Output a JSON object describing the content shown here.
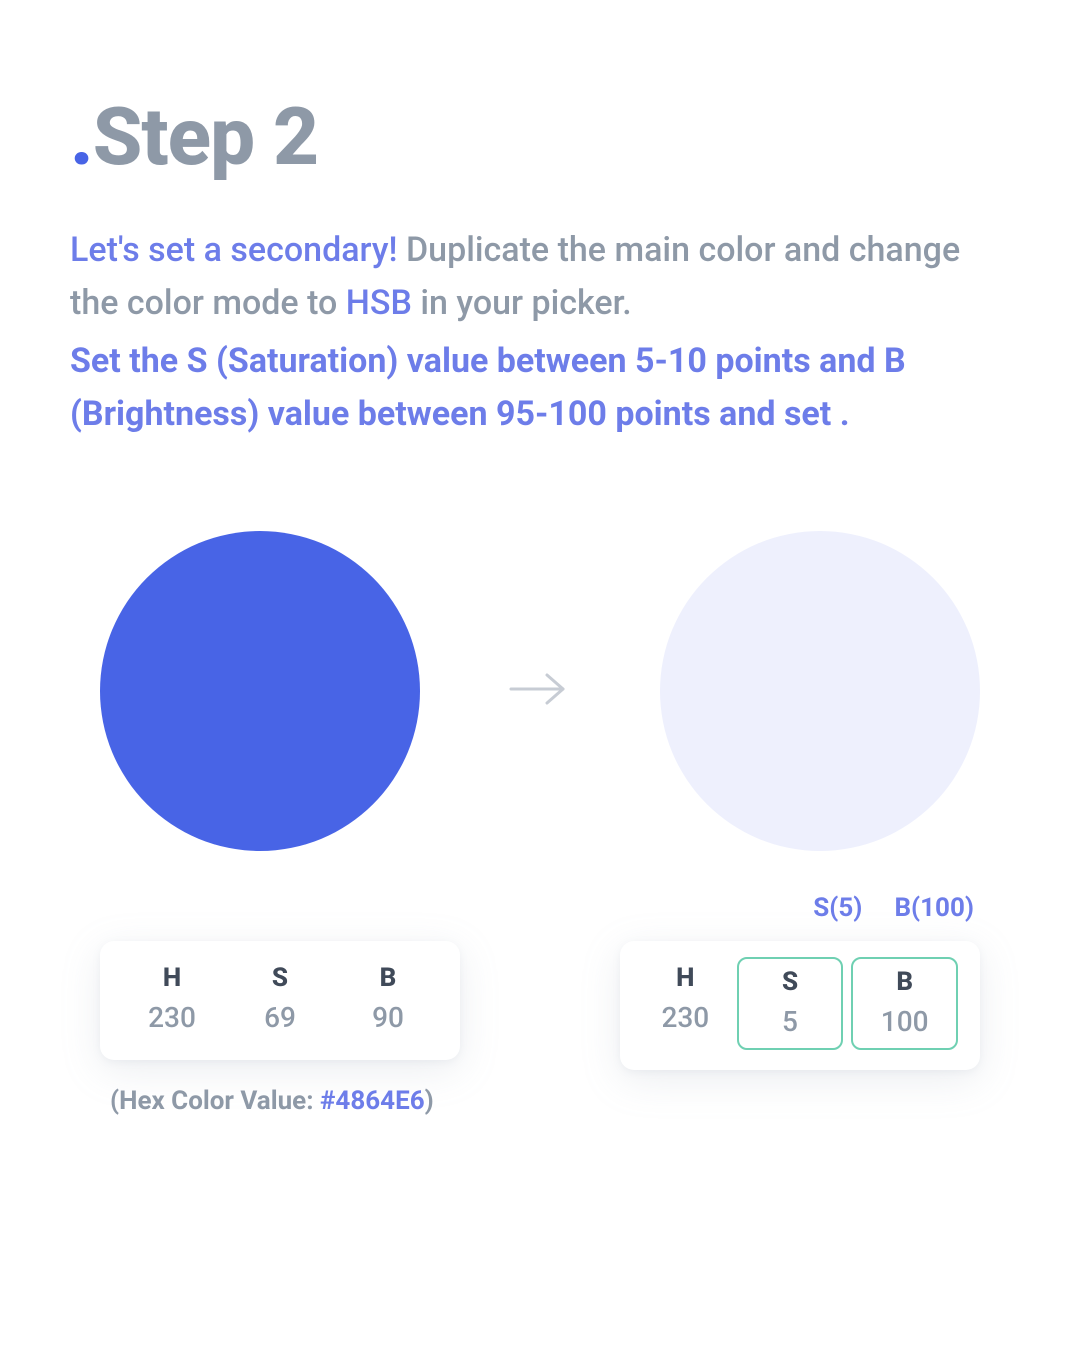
{
  "title": {
    "dot": ".",
    "text": "Step 2"
  },
  "body": {
    "lead": "Let's set a secondary!",
    "rest1": " Duplicate the main color and change the color mode to ",
    "hsb": "HSB",
    "rest2": " in your picker.",
    "bold": "Set the S (Saturation) value between 5-10 points and B (Brightness) value between 95-100 points and set ."
  },
  "colors": {
    "primary": "#4864E6",
    "secondary": "#eef0fd"
  },
  "sb_labels": {
    "s": "S(5)",
    "b": "B(100)"
  },
  "left_panel": {
    "h_label": "H",
    "h_value": "230",
    "s_label": "S",
    "s_value": "69",
    "b_label": "B",
    "b_value": "90"
  },
  "right_panel": {
    "h_label": "H",
    "h_value": "230",
    "s_label": "S",
    "s_value": "5",
    "b_label": "B",
    "b_value": "100"
  },
  "hex": {
    "prefix": "(Hex Color Value: ",
    "value": "#4864E6",
    "suffix": ")"
  }
}
